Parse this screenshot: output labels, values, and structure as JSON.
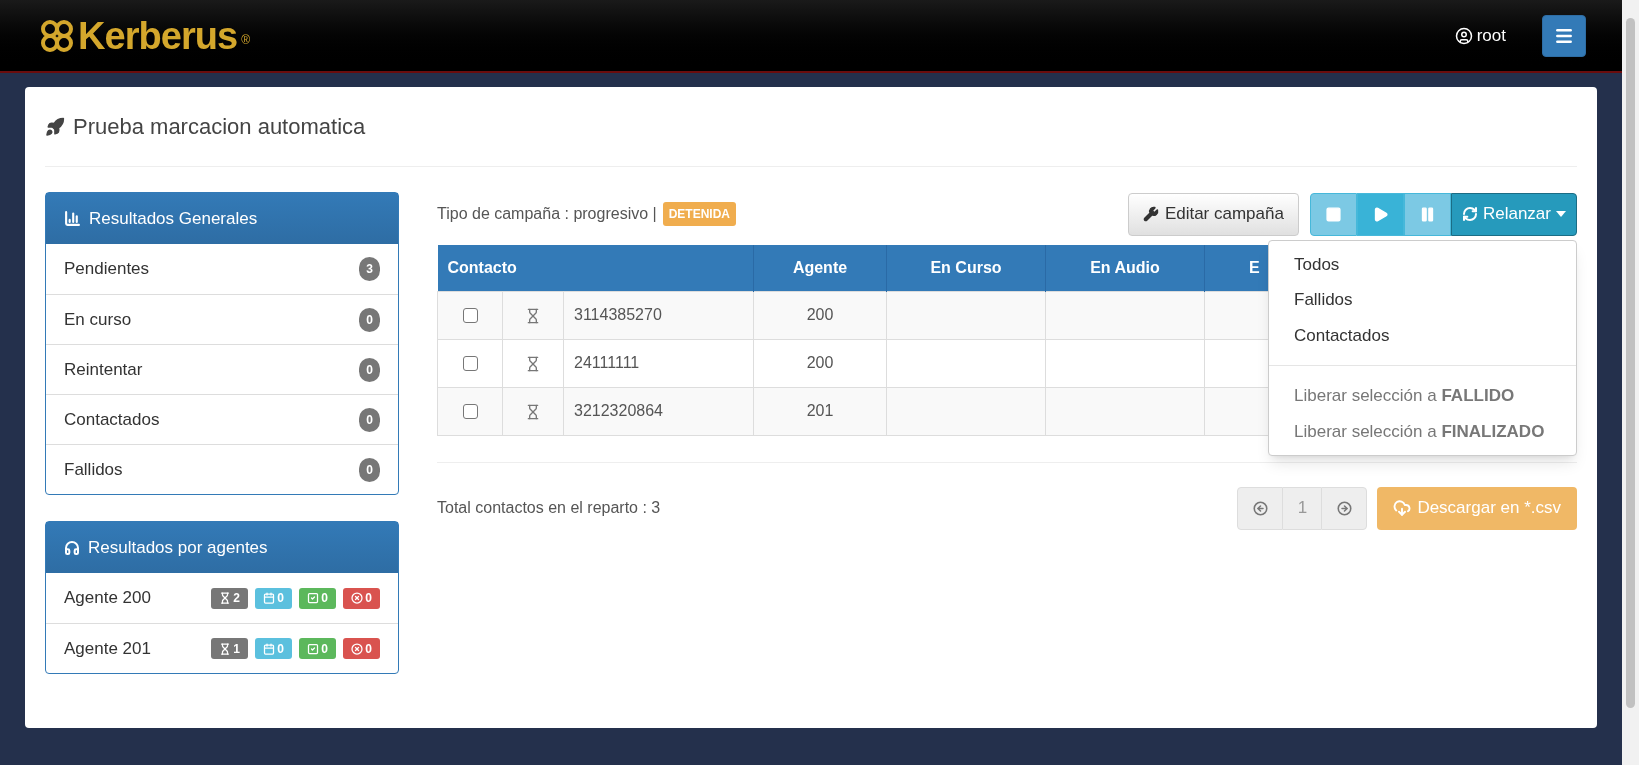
{
  "navbar": {
    "logo": {
      "name": "Kerberus",
      "mark": "®"
    },
    "user": "root"
  },
  "page": {
    "title": "Prueba marcacion automatica"
  },
  "general_results": {
    "title": "Resultados Generales",
    "items": [
      {
        "label": "Pendientes",
        "count": "3"
      },
      {
        "label": "En curso",
        "count": "0"
      },
      {
        "label": "Reintentar",
        "count": "0"
      },
      {
        "label": "Contactados",
        "count": "0"
      },
      {
        "label": "Fallidos",
        "count": "0"
      }
    ]
  },
  "agent_results": {
    "title": "Resultados por agentes",
    "agents": [
      {
        "name": "Agente 200",
        "badges": [
          {
            "kind": "pending",
            "count": "2"
          },
          {
            "kind": "scheduled",
            "count": "0"
          },
          {
            "kind": "done",
            "count": "0"
          },
          {
            "kind": "failed",
            "count": "0"
          }
        ]
      },
      {
        "name": "Agente 201",
        "badges": [
          {
            "kind": "pending",
            "count": "1"
          },
          {
            "kind": "scheduled",
            "count": "0"
          },
          {
            "kind": "done",
            "count": "0"
          },
          {
            "kind": "failed",
            "count": "0"
          }
        ]
      }
    ]
  },
  "campaign": {
    "type_label": "Tipo de campaña : progresivo |",
    "status": "DETENIDA",
    "edit_button": "Editar campaña",
    "controls": [
      {
        "kind": "stop",
        "disabled": true
      },
      {
        "kind": "play",
        "disabled": false
      },
      {
        "kind": "pause",
        "disabled": true
      }
    ],
    "relaunch": {
      "label": "Relanzar",
      "expanded": true,
      "items": [
        {
          "kind": "item",
          "text": "Todos",
          "disabled": false
        },
        {
          "kind": "item",
          "text": "Fallidos",
          "disabled": false
        },
        {
          "kind": "item",
          "text": "Contactados",
          "disabled": false
        },
        {
          "kind": "divider"
        },
        {
          "kind": "item",
          "text": "Liberar selección a **FALLIDO**",
          "disabled": true
        },
        {
          "kind": "item",
          "text": "Liberar selección a **FINALIZADO**",
          "disabled": true
        }
      ]
    }
  },
  "table": {
    "columns": [
      "Contacto",
      "Agente",
      "En Curso",
      "En Audio",
      "E"
    ],
    "rows": [
      {
        "checked": false,
        "contact": "3114385270",
        "agent": "200"
      },
      {
        "checked": false,
        "contact": "24111111",
        "agent": "200"
      },
      {
        "checked": false,
        "contact": "3212320864",
        "agent": "201"
      }
    ]
  },
  "footer": {
    "total": "Total contactos en el reparto : 3",
    "page": "1",
    "prev_disabled": true,
    "next_disabled": true,
    "download": {
      "label": "Descargar en *.csv",
      "disabled": true
    }
  }
}
